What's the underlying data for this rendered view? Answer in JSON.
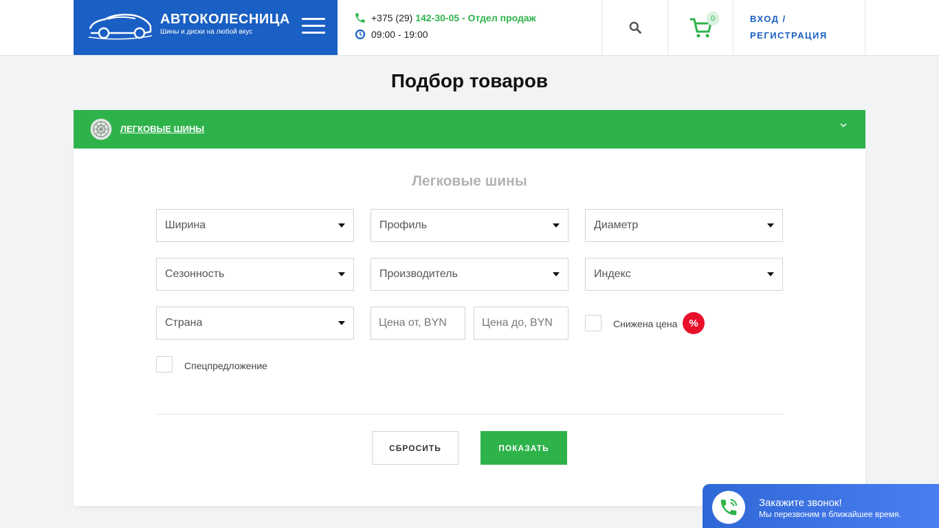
{
  "header": {
    "logo_title": "АВТОКОЛЕСНИЦА",
    "logo_subtitle": "Шины и диски на любой вкус",
    "phone_prefix": "+375 (29)",
    "phone_main": "142-30-05 - Отдел продаж",
    "hours": "09:00 - 19:00",
    "cart_count": "0",
    "login_line1": "ВХОД /",
    "login_line2": "РЕГИСТРАЦИЯ",
    "accent_color": "#1a5fc4",
    "green_color": "#2db34a"
  },
  "page": {
    "title": "Подбор товаров"
  },
  "accordion": {
    "label": "ЛЕГКОВЫЕ ШИНЫ"
  },
  "filter": {
    "title": "Легковые шины",
    "selects": {
      "width": "Ширина",
      "profile": "Профиль",
      "diameter": "Диаметр",
      "season": "Сезонность",
      "manufacturer": "Производитель",
      "index": "Индекс",
      "country": "Страна"
    },
    "price_from_placeholder": "Цена от, BYN",
    "price_to_placeholder": "Цена до, BYN",
    "reduced_price_label": "Снижена цена",
    "sale_badge": "%",
    "special_offer_label": "Спецпредложение",
    "reset_label": "СБРОСИТЬ",
    "show_label": "ПОКАЗАТЬ"
  },
  "callback": {
    "title": "Закажите звонок!",
    "subtitle": "Мы перезвоним в ближайшее время."
  }
}
